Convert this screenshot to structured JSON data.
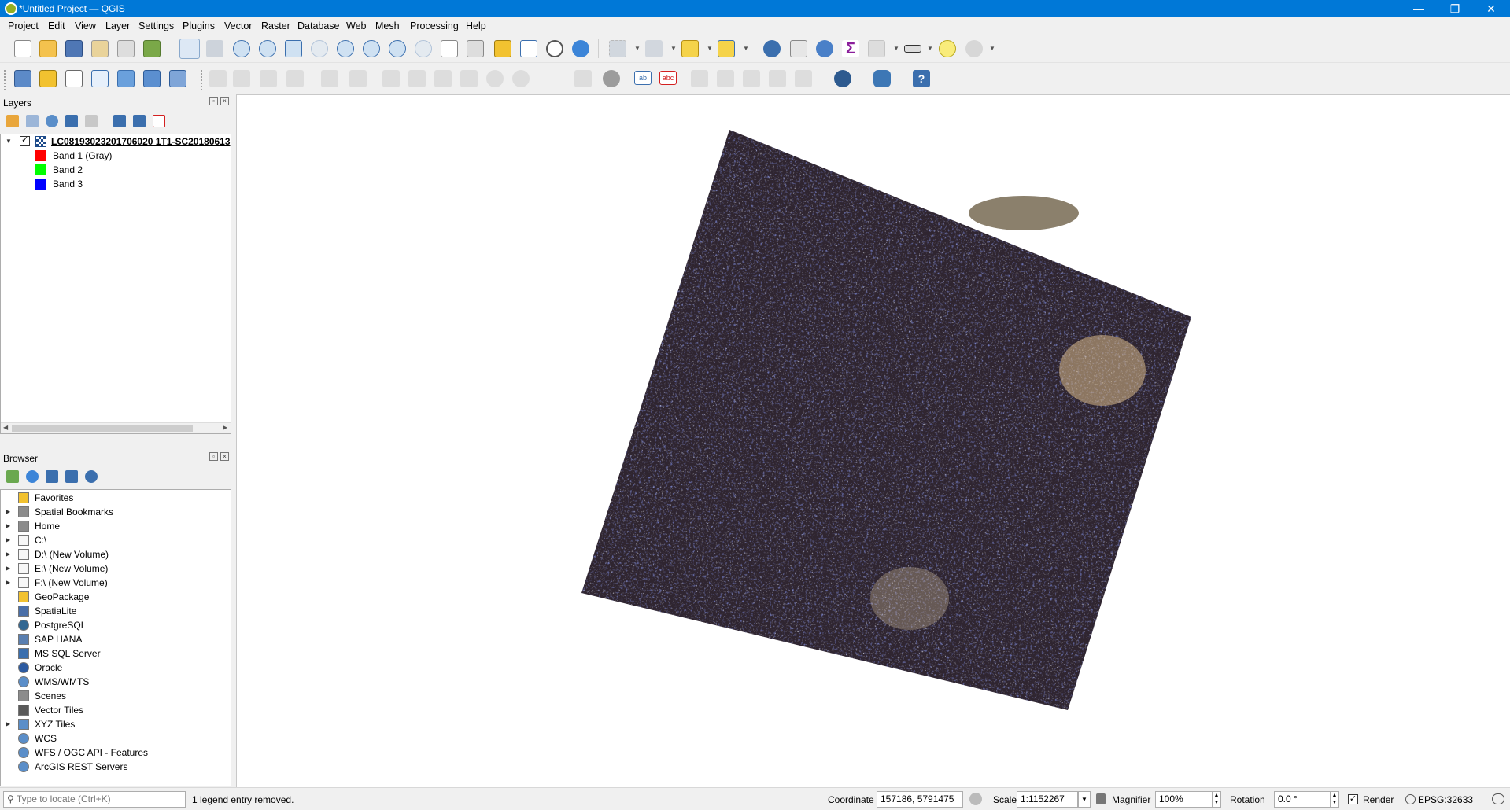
{
  "window": {
    "title": "*Untitled Project — QGIS",
    "minimize": "—",
    "restore": "❐",
    "close": "✕"
  },
  "menu": [
    "Project",
    "Edit",
    "View",
    "Layer",
    "Settings",
    "Plugins",
    "Vector",
    "Raster",
    "Database",
    "Web",
    "Mesh",
    "Processing",
    "Help"
  ],
  "layers_panel": {
    "title": "Layers",
    "layer_name": "LC08193023201706020 1T1-SC20180613",
    "bands": [
      {
        "label": "Band 1 (Gray)",
        "color": "#ff0000"
      },
      {
        "label": "Band 2",
        "color": "#00ff00"
      },
      {
        "label": "Band 3",
        "color": "#0000ff"
      }
    ]
  },
  "browser_panel": {
    "title": "Browser",
    "items": [
      {
        "label": "Favorites",
        "icon": "star-icon",
        "expandable": false
      },
      {
        "label": "Spatial Bookmarks",
        "icon": "bookmark-icon",
        "expandable": true
      },
      {
        "label": "Home",
        "icon": "home-icon",
        "expandable": true
      },
      {
        "label": "C:\\",
        "icon": "folder-icon",
        "expandable": true
      },
      {
        "label": "D:\\ (New Volume)",
        "icon": "folder-icon",
        "expandable": true
      },
      {
        "label": "E:\\ (New Volume)",
        "icon": "folder-icon",
        "expandable": true
      },
      {
        "label": "F:\\ (New Volume)",
        "icon": "folder-icon",
        "expandable": true
      },
      {
        "label": "GeoPackage",
        "icon": "geopackage-icon",
        "expandable": false
      },
      {
        "label": "SpatiaLite",
        "icon": "spatialite-icon",
        "expandable": false
      },
      {
        "label": "PostgreSQL",
        "icon": "postgresql-icon",
        "expandable": false
      },
      {
        "label": "SAP HANA",
        "icon": "sap-hana-icon",
        "expandable": false
      },
      {
        "label": "MS SQL Server",
        "icon": "mssql-icon",
        "expandable": false
      },
      {
        "label": "Oracle",
        "icon": "oracle-icon",
        "expandable": false
      },
      {
        "label": "WMS/WMTS",
        "icon": "globe-icon",
        "expandable": false
      },
      {
        "label": "Scenes",
        "icon": "scenes-icon",
        "expandable": false
      },
      {
        "label": "Vector Tiles",
        "icon": "vector-tiles-icon",
        "expandable": false
      },
      {
        "label": "XYZ Tiles",
        "icon": "xyz-tiles-icon",
        "expandable": true
      },
      {
        "label": "WCS",
        "icon": "globe-icon",
        "expandable": false
      },
      {
        "label": "WFS / OGC API - Features",
        "icon": "wfs-icon",
        "expandable": false
      },
      {
        "label": "ArcGIS REST Servers",
        "icon": "arcgis-icon",
        "expandable": false
      }
    ]
  },
  "statusbar": {
    "locator_placeholder": "Type to locate (Ctrl+K)",
    "message": "1 legend entry removed.",
    "coordinate_label": "Coordinate",
    "coordinate_value": "157186, 5791475",
    "scale_label": "Scale",
    "scale_value": "1:1152267",
    "magnifier_label": "Magnifier",
    "magnifier_value": "100%",
    "rotation_label": "Rotation",
    "rotation_value": "0.0 °",
    "render_label": "Render",
    "crs": "EPSG:32633"
  }
}
